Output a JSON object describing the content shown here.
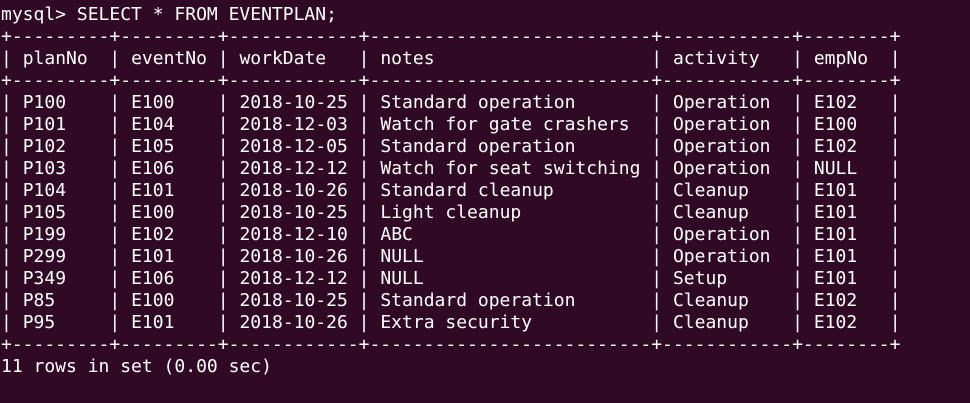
{
  "terminal": {
    "prompt": "mysql> ",
    "command": "SELECT * FROM EVENTPLAN;",
    "border": "+---------+---------+------------+--------------------------+------------+--------+",
    "columns": [
      "planNo",
      "eventNo",
      "workDate",
      "notes",
      "activity",
      "empNo"
    ],
    "rows": [
      [
        "P100",
        "E100",
        "2018-10-25",
        "Standard operation",
        "Operation",
        "E102"
      ],
      [
        "P101",
        "E104",
        "2018-12-03",
        "Watch for gate crashers",
        "Operation",
        "E100"
      ],
      [
        "P102",
        "E105",
        "2018-12-05",
        "Standard operation",
        "Operation",
        "E102"
      ],
      [
        "P103",
        "E106",
        "2018-12-12",
        "Watch for seat switching",
        "Operation",
        "NULL"
      ],
      [
        "P104",
        "E101",
        "2018-10-26",
        "Standard cleanup",
        "Cleanup",
        "E101"
      ],
      [
        "P105",
        "E100",
        "2018-10-25",
        "Light cleanup",
        "Cleanup",
        "E101"
      ],
      [
        "P199",
        "E102",
        "2018-12-10",
        "ABC",
        "Operation",
        "E101"
      ],
      [
        "P299",
        "E101",
        "2018-10-26",
        "NULL",
        "Operation",
        "E101"
      ],
      [
        "P349",
        "E106",
        "2018-12-12",
        "NULL",
        "Setup",
        "E101"
      ],
      [
        "P85",
        "E100",
        "2018-10-25",
        "Standard operation",
        "Cleanup",
        "E102"
      ],
      [
        "P95",
        "E101",
        "2018-10-26",
        "Extra security",
        "Cleanup",
        "E102"
      ]
    ],
    "summary": "11 rows in set (0.00 sec)",
    "colors": {
      "background": "#300a24",
      "foreground": "#ffffff"
    }
  }
}
